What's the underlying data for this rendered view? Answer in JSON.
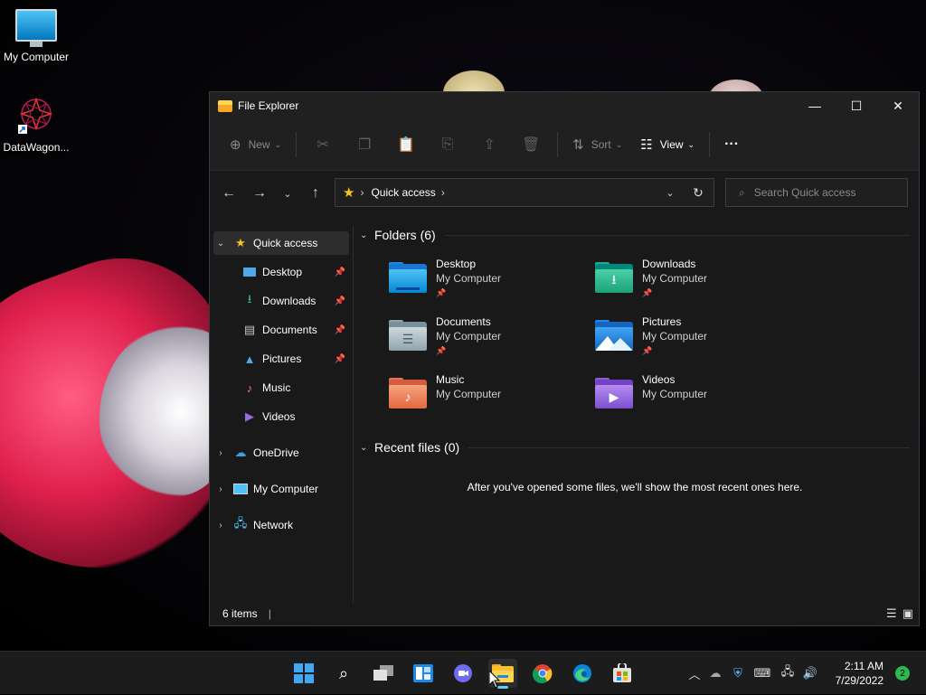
{
  "desktop": {
    "icons": [
      {
        "label": "My Computer"
      },
      {
        "label": "DataWagon..."
      }
    ]
  },
  "window": {
    "title": "File Explorer",
    "controls": {
      "minimize": "—",
      "maximize": "☐",
      "close": "✕"
    },
    "commandbar": {
      "new_label": "New",
      "sort_label": "Sort",
      "view_label": "View",
      "more_label": "···"
    },
    "address": {
      "crumb": "Quick access",
      "search_placeholder": "Search Quick access"
    },
    "navpane": {
      "quick_access": "Quick access",
      "items": [
        {
          "label": "Desktop",
          "pinned": true
        },
        {
          "label": "Downloads",
          "pinned": true
        },
        {
          "label": "Documents",
          "pinned": true
        },
        {
          "label": "Pictures",
          "pinned": true
        },
        {
          "label": "Music",
          "pinned": false
        },
        {
          "label": "Videos",
          "pinned": false
        }
      ],
      "onedrive": "OneDrive",
      "my_computer": "My Computer",
      "network": "Network"
    },
    "content": {
      "folders_header": "Folders (6)",
      "folders": [
        {
          "name": "Desktop",
          "location": "My Computer",
          "pinned": true
        },
        {
          "name": "Downloads",
          "location": "My Computer",
          "pinned": true
        },
        {
          "name": "Documents",
          "location": "My Computer",
          "pinned": true
        },
        {
          "name": "Pictures",
          "location": "My Computer",
          "pinned": true
        },
        {
          "name": "Music",
          "location": "My Computer",
          "pinned": false
        },
        {
          "name": "Videos",
          "location": "My Computer",
          "pinned": false
        }
      ],
      "recent_header": "Recent files (0)",
      "recent_empty": "After you've opened some files, we'll show the most recent ones here."
    },
    "status": {
      "item_count": "6 items",
      "separator": "|"
    }
  },
  "taskbar": {
    "apps": [
      "start",
      "search",
      "task-view",
      "widgets",
      "chat",
      "file-explorer",
      "chrome",
      "edge",
      "store"
    ],
    "active_app": "file-explorer",
    "clock_time": "2:11 AM",
    "clock_date": "7/29/2022",
    "notification_count": "2"
  },
  "colors": {
    "accent": "#60cdff",
    "window_bg": "#191919",
    "titlebar_bg": "#202020",
    "star": "#f5c518"
  }
}
